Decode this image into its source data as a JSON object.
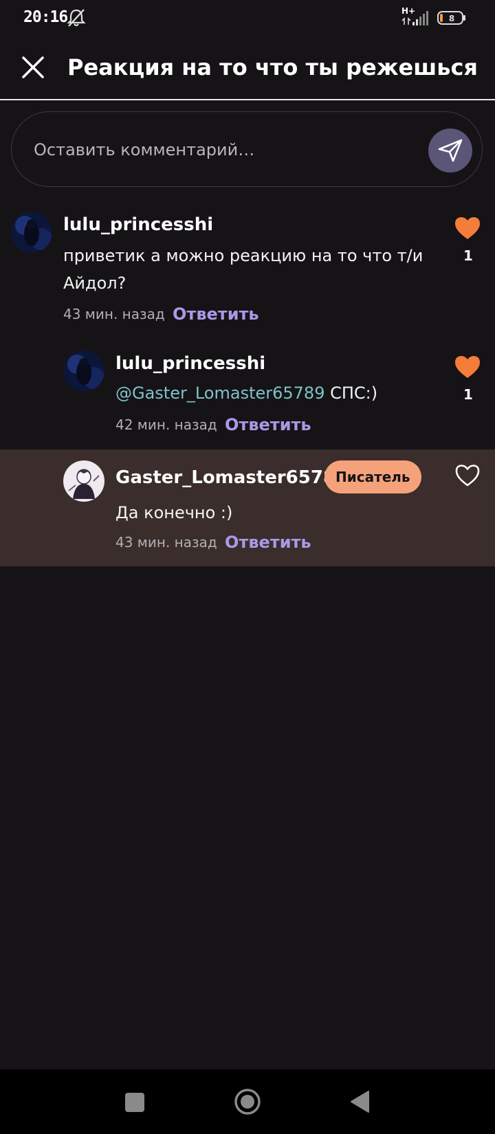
{
  "status_bar": {
    "time": "20:16",
    "network": "H+",
    "battery_level": "8"
  },
  "header": {
    "title": "Реакция на то что ты режешься"
  },
  "comment_input": {
    "placeholder": "Оставить комментарий…"
  },
  "comments": [
    {
      "username": "lulu_princesshi",
      "text": "приветик а можно реакцию на то что т/и Айдол?",
      "time": "43 мин. назад",
      "reply_label": "Ответить",
      "likes": "1",
      "liked": true
    },
    {
      "username": "lulu_princesshi",
      "mention": "@Gaster_Lomaster65789",
      "text": "СПС:)",
      "time": "42 мин. назад",
      "reply_label": "Ответить",
      "likes": "1",
      "liked": true
    },
    {
      "username": "Gaster_Lomaster65789",
      "badge": "Писатель",
      "text": "Да конечно :)",
      "time": "43 мин. назад",
      "reply_label": "Ответить",
      "liked": false
    }
  ],
  "colors": {
    "background": "#151316",
    "accent_like": "#f47d3a",
    "reply_link": "#a89ae6",
    "mention": "#7ec2c8",
    "badge_bg": "#f5a27a",
    "highlight_row": "#3a2d2b"
  },
  "icons": {
    "close": "close-icon",
    "send": "send-icon",
    "like_filled": "heart-filled-icon",
    "like_outline": "heart-outline-icon",
    "nav_recent": "square-icon",
    "nav_home": "circle-icon",
    "nav_back": "triangle-back-icon"
  }
}
